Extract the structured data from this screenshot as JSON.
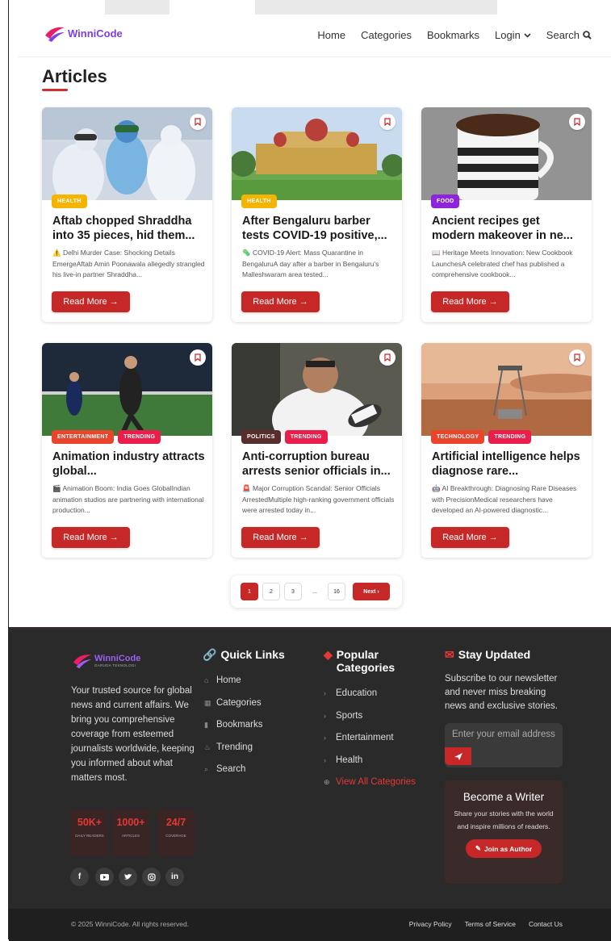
{
  "brand": {
    "name": "WinniCode",
    "tagline": "GARUDA TEKNOLOGI"
  },
  "nav": {
    "home": "Home",
    "categories": "Categories",
    "bookmarks": "Bookmarks",
    "login": "Login",
    "search": "Search"
  },
  "page": {
    "title": "Articles"
  },
  "articles": [
    {
      "badges": [
        "HEALTH"
      ],
      "title": "Aftab chopped Shraddha into 35 pieces, hid them...",
      "excerpt": "⚠️ Delhi Murder Case: Shocking Details EmergeAftab Amin Poonawala allegedly strangled his live-in partner Shraddha...",
      "cta": "Read More →"
    },
    {
      "badges": [
        "HEALTH"
      ],
      "title": "After Bengaluru barber tests COVID-19 positive,...",
      "excerpt": "🦠 COVID-19 Alert: Mass Quarantine in BengaluruA day after a barber in Bengaluru's Malleshwaram area tested...",
      "cta": "Read More →"
    },
    {
      "badges": [
        "FOOD"
      ],
      "title": "Ancient recipes get modern makeover in ne...",
      "excerpt": "📖 Heritage Meets Innovation: New Cookbook LaunchesA celebrated chef has published a comprehensive cookbook...",
      "cta": "Read More →"
    },
    {
      "badges": [
        "ENTERTAINMENT",
        "TRENDING"
      ],
      "title": "Animation industry attracts global...",
      "excerpt": "🎬 Animation Boom: India Goes GlobalIndian animation studios are partnering with international production...",
      "cta": "Read More →"
    },
    {
      "badges": [
        "POLITICS",
        "TRENDING"
      ],
      "title": "Anti-corruption bureau arrests senior officials in...",
      "excerpt": "🚨 Major Corruption Scandal: Senior Officials ArrestedMultiple high-ranking government officials were arrested today in...",
      "cta": "Read More →"
    },
    {
      "badges": [
        "TECHNOLOGY",
        "TRENDING"
      ],
      "title": "Artificial intelligence helps diagnose rare...",
      "excerpt": "🤖 AI Breakthrough: Diagnosing Rare Diseases with PrecisionMedical researchers have developed an AI-powered diagnostic...",
      "cta": "Read More →"
    }
  ],
  "badge_colors": {
    "HEALTH": "#f5b400",
    "FOOD": "#8e24d9",
    "ENTERTAINMENT": "#e8452c",
    "TRENDING": "#e91e4a",
    "POLITICS": "#5a2d2d",
    "TECHNOLOGY": "#e8452c"
  },
  "pagination": {
    "pages": [
      "1",
      "2",
      "3",
      "...",
      "16"
    ],
    "current": "1",
    "next": "Next ›"
  },
  "footer": {
    "about": "Your trusted source for global news and current affairs. We bring you comprehensive coverage from esteemed journalists worldwide, keeping you informed about what matters most.",
    "stats": [
      {
        "value": "50K+",
        "label": "DAILY READERS"
      },
      {
        "value": "1000+",
        "label": "ARTICLES"
      },
      {
        "value": "24/7",
        "label": "COVERAGE"
      }
    ],
    "social": [
      "facebook-icon",
      "youtube-icon",
      "twitter-icon",
      "instagram-icon",
      "linkedin-icon"
    ],
    "quick_links_title": "Quick Links",
    "quick_links": [
      "Home",
      "Categories",
      "Bookmarks",
      "Trending",
      "Search"
    ],
    "popular_title": "Popular Categories",
    "popular": [
      "Education",
      "Sports",
      "Entertainment",
      "Health"
    ],
    "view_all": "View All Categories",
    "newsletter_title": "Stay Updated",
    "newsletter_text": "Subscribe to our newsletter and never miss breaking news and exclusive stories.",
    "email_placeholder": "Enter your email address",
    "writer_title": "Become a Writer",
    "writer_text": "Share your stories with the world and inspire millions of readers.",
    "writer_cta": "Join as Author",
    "copyright": "© 2025 WinniCode. All rights reserved.",
    "legal": [
      "Privacy Policy",
      "Terms of Service",
      "Contact Us"
    ]
  },
  "colors": {
    "accent": "#c62828",
    "footer_bg": "#2a2a2a",
    "brand": "#7b3fe4"
  }
}
